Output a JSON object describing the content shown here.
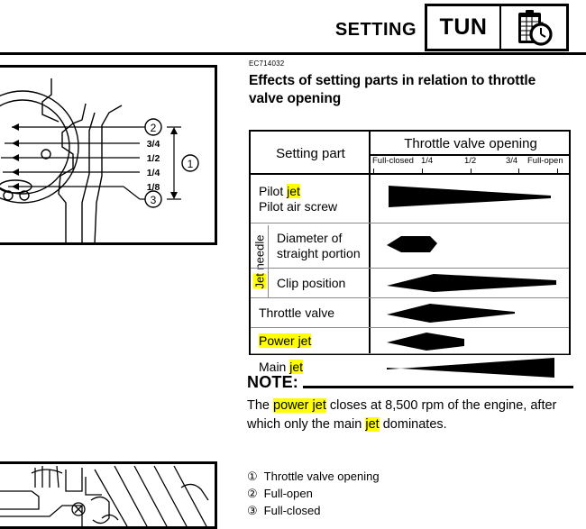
{
  "header": {
    "title": "SETTING",
    "tun_label": "TUN",
    "icon": "clipboard-stopwatch-icon"
  },
  "content": {
    "doc_code": "EC714032",
    "section_title": "Effects of setting parts in relation to throttle valve opening"
  },
  "table": {
    "header_setting_part": "Setting part",
    "header_throttle": "Throttle valve opening",
    "ticks": [
      {
        "label": "Full-closed",
        "pos": 0
      },
      {
        "label": "1/4",
        "pos": 25
      },
      {
        "label": "1/2",
        "pos": 50
      },
      {
        "label": "3/4",
        "pos": 75
      },
      {
        "label": "Full-open",
        "pos": 100
      }
    ],
    "group_label": "Jet needle",
    "group_label_highlight": "Jet",
    "rows": [
      {
        "name": "pilot-jet",
        "line1_pre": "Pilot ",
        "line1_hl": "jet",
        "line2": "Pilot air screw",
        "shape": "taper-right-thin"
      },
      {
        "name": "diameter-straight-portion",
        "line1_pre": "Diameter of",
        "line1_hl": "",
        "line2": "straight portion",
        "shape": "short-hex"
      },
      {
        "name": "clip-position",
        "line1_pre": "Clip position",
        "line1_hl": "",
        "line2": "",
        "shape": "long-lens"
      },
      {
        "name": "throttle-valve",
        "line1_pre": "Throttle valve",
        "line1_hl": "",
        "line2": "",
        "shape": "mid-lens"
      },
      {
        "name": "power-jet",
        "line1_pre": "",
        "line1_hl": "Power jet",
        "line2": "",
        "shape": "short-lens"
      },
      {
        "name": "main-jet",
        "line1_pre": "Main ",
        "line1_hl": "jet",
        "line2": "",
        "shape": "taper-right-wide"
      }
    ]
  },
  "note": {
    "heading": "NOTE:",
    "text_part1": "The ",
    "text_hl1": "power jet",
    "text_part2": " closes at 8,500 rpm of the engine, after which only the main ",
    "text_hl2": "jet",
    "text_part3": " dominates."
  },
  "legend": {
    "items": [
      {
        "num": "①",
        "label": "Throttle valve opening"
      },
      {
        "num": "②",
        "label": "Full-open"
      },
      {
        "num": "③",
        "label": "Full-closed"
      }
    ]
  },
  "illustration_top": {
    "callout_2": "②",
    "callout_3": "③",
    "callout_1": "①",
    "marks": [
      "3/4",
      "1/2",
      "1/4",
      "1/8"
    ]
  },
  "colors": {
    "highlight": "#ffff00",
    "ink": "#000000",
    "rule": "#8a8a8a"
  }
}
